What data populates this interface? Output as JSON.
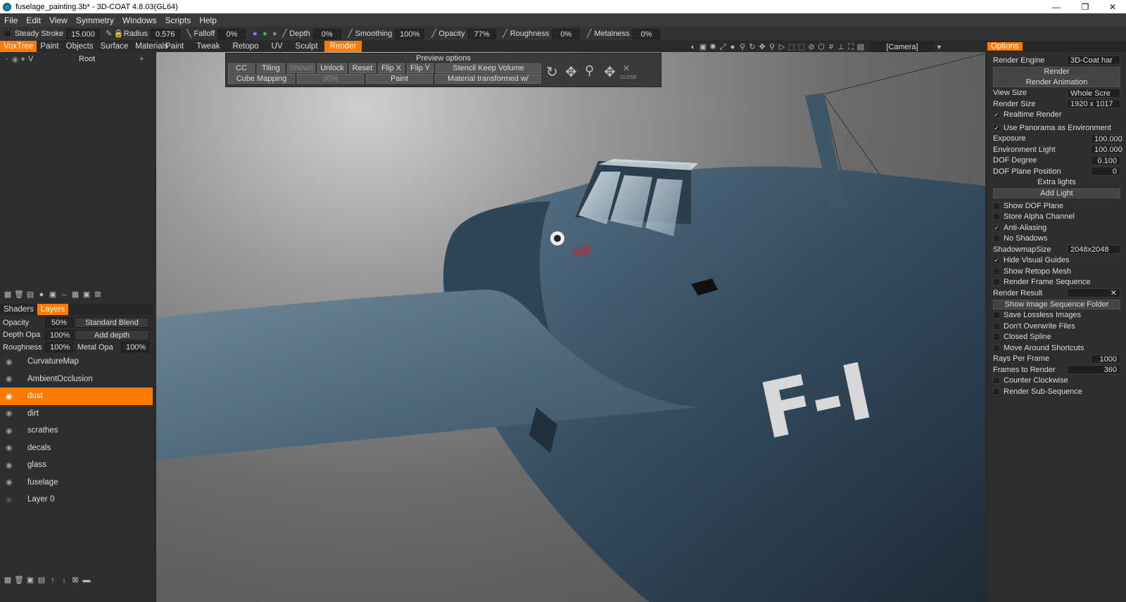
{
  "window": {
    "title": "fuselage_painting.3b* - 3D-COAT 4.8.03(GL64)",
    "minimize": "—",
    "maximize": "❐",
    "close": "✕"
  },
  "menu": [
    "File",
    "Edit",
    "View",
    "Symmetry",
    "Windows",
    "Scripts",
    "Help"
  ],
  "toolbar": {
    "steady_stroke": {
      "label": "Steady Stroke",
      "value": "15.000"
    },
    "radius": {
      "label": "Radius",
      "value": "0.576"
    },
    "falloff": {
      "label": "Falloff",
      "value": "0%"
    },
    "depth": {
      "label": "Depth",
      "value": "0%"
    },
    "smoothing": {
      "label": "Smoothing",
      "value": "100%"
    },
    "opacity": {
      "label": "Opacity",
      "value": "77%"
    },
    "roughness": {
      "label": "Roughness",
      "value": "0%"
    },
    "metalness": {
      "label": "Metalness",
      "value": "0%"
    },
    "camera": "[Camera]"
  },
  "left_tabs": [
    "VoxTree",
    "Paint",
    "Objects",
    "Surface",
    "Materials"
  ],
  "room_tabs": [
    "Paint",
    "Tweak",
    "Retopo",
    "UV",
    "Sculpt",
    "Render"
  ],
  "voxtree": {
    "root": "Root",
    "v": "V",
    "add": "+"
  },
  "layers_tabs": [
    "Shaders",
    "Layers"
  ],
  "layer_props": {
    "opacity_label": "Opacity",
    "opacity_value": "50%",
    "blend": "Standard Blend",
    "depth_label": "Depth Opa",
    "depth_value": "100%",
    "add_depth": "Add depth",
    "rough_label": "Roughness",
    "rough_value": "100%",
    "metal_label": "Metal Opa",
    "metal_value": "100%"
  },
  "layers": [
    "CurvatureMap",
    "AmbientOcclusion",
    "dust",
    "dirt",
    "scrathes",
    "decals",
    "glass",
    "fuselage",
    "Layer 0"
  ],
  "preview": {
    "title": "Preview options",
    "cc": "CC",
    "tiling": "Tiling",
    "shown": "Shown",
    "unlock": "Unlock",
    "reset": "Reset",
    "flipx": "Flip X",
    "flipy": "Flip Y",
    "stencil": "Stencil Keep Volume",
    "cube": "Cube Mapping",
    "pct": "30%",
    "paint": "Paint",
    "material": "Material transformed w/",
    "close": "CLOSE"
  },
  "options_tab": "Options",
  "options": {
    "render_engine_label": "Render Engine",
    "render_engine_value": "3D-Coat har",
    "render_btn": "Render",
    "render_anim_btn": "Render Animation",
    "view_size_label": "View Size",
    "view_size_value": "Whole Scre",
    "render_size_label": "Render Size",
    "render_size_value": "1920 x 1017",
    "realtime": "Realtime Render",
    "use_panorama": "Use Panorama as Environment",
    "exposure_label": "Exposure",
    "exposure_value": "100.000",
    "env_light_label": "Environment Light",
    "env_light_value": "100.000",
    "dof_degree_label": "DOF Degree",
    "dof_degree_value": "0.100",
    "dof_plane_label": "DOF Plane Position",
    "dof_plane_value": "0",
    "extra_lights": "Extra lights",
    "add_light": "Add Light",
    "show_dof": "Show DOF Plane",
    "store_alpha": "Store Alpha Channel",
    "anti_alias": "Anti-Aliasing",
    "no_shadows": "No Shadows",
    "shadowmap_label": "ShadowmapSize",
    "shadowmap_value": "2048x2048",
    "hide_guides": "Hide Visual Guides",
    "show_retopo": "Show Retopo Mesh",
    "render_frame_seq": "Render Frame Sequence",
    "render_result": "Render Result",
    "show_seq_folder": "Show Image Sequence Folder",
    "save_lossless": "Save Lossless Images",
    "dont_overwrite": "Don't Overwrite Files",
    "closed_spline": "Closed Spline",
    "move_around": "Move Around Shortcuts",
    "rays_label": "Rays Per Frame",
    "rays_value": "1000",
    "frames_label": "Frames to Render",
    "frames_value": "360",
    "counter_cw": "Counter Clockwise",
    "render_subseq": "Render Sub-Sequence"
  },
  "viewport_marking": "F-I",
  "kanji": "海軍"
}
